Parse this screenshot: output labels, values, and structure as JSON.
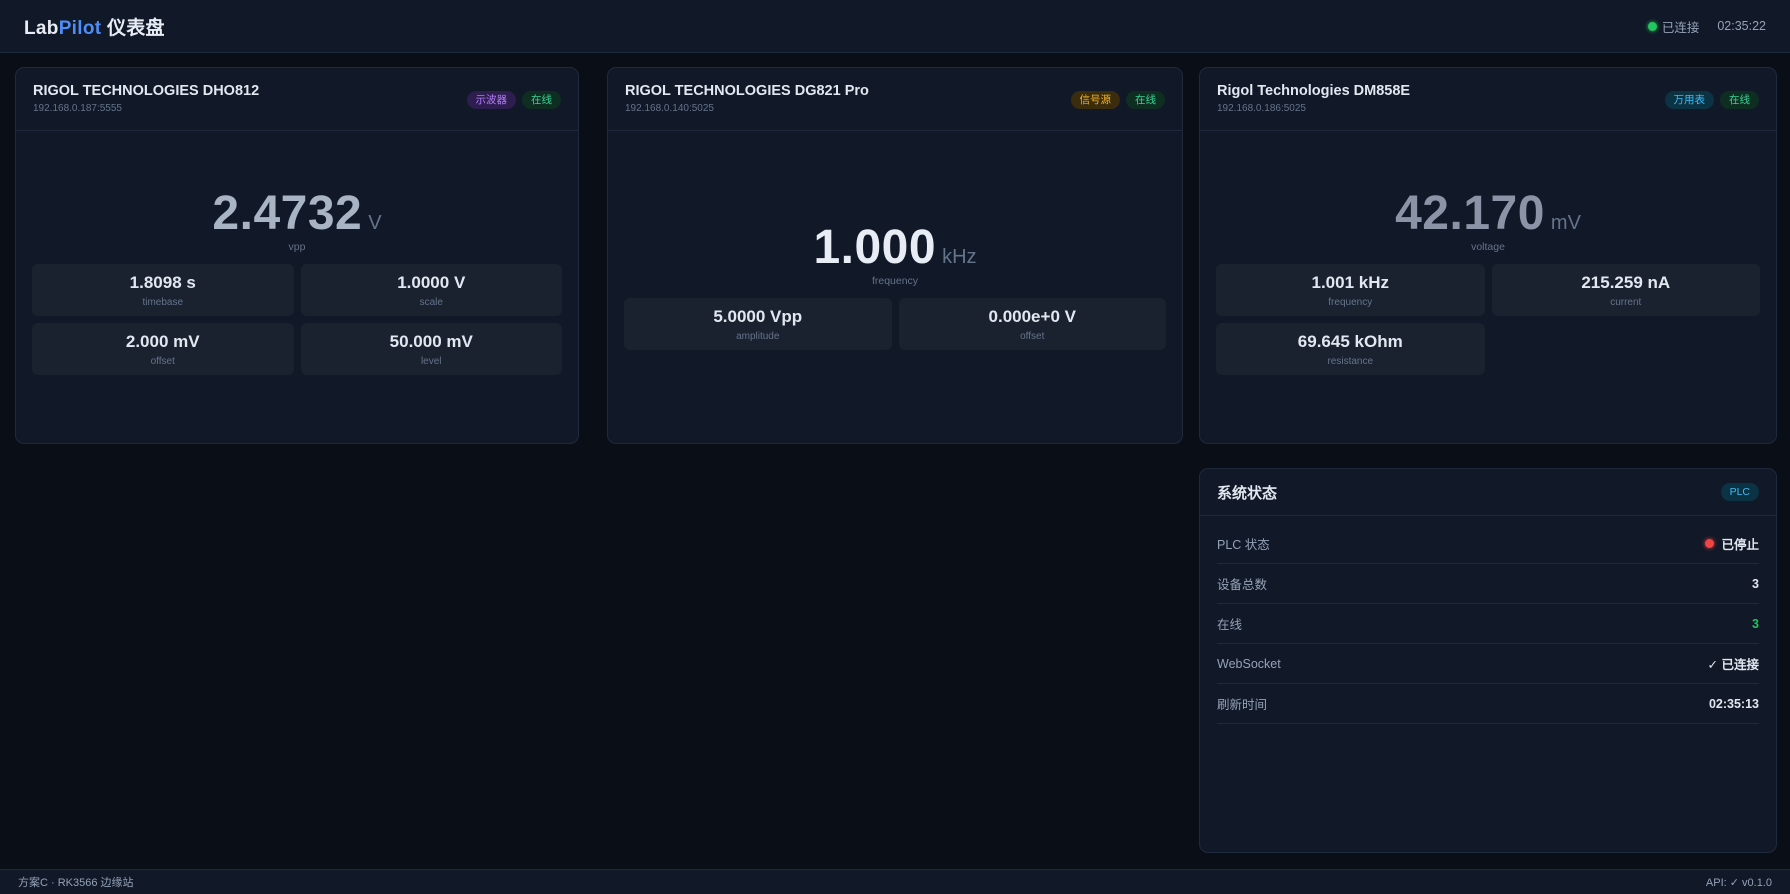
{
  "header": {
    "brand_a": "Lab",
    "brand_b": "Pilot",
    "brand_c": " 仪表盘",
    "connection": "已连接",
    "time": "02:35:22"
  },
  "devices": [
    {
      "name": "RIGOL TECHNOLOGIES DHO812",
      "address": "192.168.0.187:5555",
      "type_badge": "示波器",
      "status_badge": "在线",
      "main": {
        "value": "2.4732",
        "unit": "V",
        "label": "vpp"
      },
      "metrics": [
        {
          "value": "1.8098 s",
          "label": "timebase"
        },
        {
          "value": "1.0000 V",
          "label": "scale"
        },
        {
          "value": "2.000 mV",
          "label": "offset"
        },
        {
          "value": "50.000 mV",
          "label": "level"
        }
      ]
    },
    {
      "name": "RIGOL TECHNOLOGIES DG821 Pro",
      "address": "192.168.0.140:5025",
      "type_badge": "信号源",
      "status_badge": "在线",
      "main": {
        "value": "1.000",
        "unit": "kHz",
        "label": "frequency"
      },
      "metrics": [
        {
          "value": "5.0000 Vpp",
          "label": "amplitude"
        },
        {
          "value": "0.000e+0 V",
          "label": "offset"
        }
      ]
    },
    {
      "name": "Rigol Technologies DM858E",
      "address": "192.168.0.186:5025",
      "type_badge": "万用表",
      "status_badge": "在线",
      "main": {
        "value": "42.170",
        "unit": "mV",
        "label": "voltage"
      },
      "metrics": [
        {
          "value": "1.001 kHz",
          "label": "frequency"
        },
        {
          "value": "215.259 nA",
          "label": "current"
        },
        {
          "value": "69.645 kOhm",
          "label": "resistance"
        }
      ]
    }
  ],
  "system": {
    "title": "系统状态",
    "badge": "PLC",
    "rows": [
      {
        "key": "PLC 状态",
        "value": "已停止"
      },
      {
        "key": "设备总数",
        "value": "3"
      },
      {
        "key": "在线",
        "value": "3"
      },
      {
        "key": "WebSocket",
        "value": "✓ 已连接"
      },
      {
        "key": "刷新时间",
        "value": "02:35:13"
      }
    ]
  },
  "footer": {
    "left": "方案C · RK3566 边缘站",
    "right": "API: ✓ v0.1.0"
  },
  "colors": {
    "background": "#0a0e16",
    "card": "#111827",
    "accent": "#4c8df6",
    "online": "#22c55e",
    "stopped": "#ef4444"
  }
}
